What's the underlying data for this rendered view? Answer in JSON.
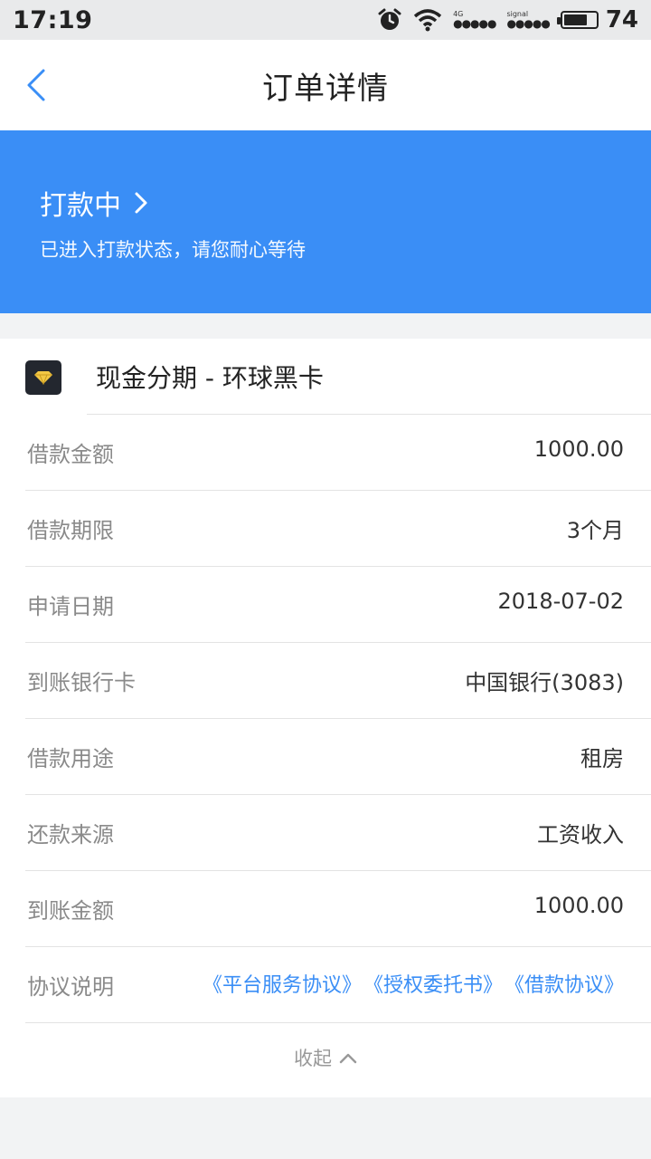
{
  "status_bar": {
    "time": "17:19",
    "network": "4G",
    "signal_label_1": "signal",
    "signal_label_2": "signal",
    "battery": "74"
  },
  "nav": {
    "title": "订单详情"
  },
  "banner": {
    "status": "打款中",
    "description": "已进入打款状态，请您耐心等待",
    "color": "#3a8ef6"
  },
  "product": {
    "name": "现金分期 - 环球黑卡"
  },
  "details": [
    {
      "label": "借款金额",
      "value": "1000.00"
    },
    {
      "label": "借款期限",
      "value": "3个月"
    },
    {
      "label": "申请日期",
      "value": "2018-07-02"
    },
    {
      "label": "到账银行卡",
      "value": "中国银行(3083)"
    },
    {
      "label": "借款用途",
      "value": "租房"
    },
    {
      "label": "还款来源",
      "value": "工资收入"
    },
    {
      "label": "到账金额",
      "value": "1000.00"
    }
  ],
  "agreement": {
    "label": "协议说明",
    "links": [
      "《平台服务协议》",
      "《授权委托书》",
      "《借款协议》"
    ]
  },
  "collapse_label": "收起"
}
